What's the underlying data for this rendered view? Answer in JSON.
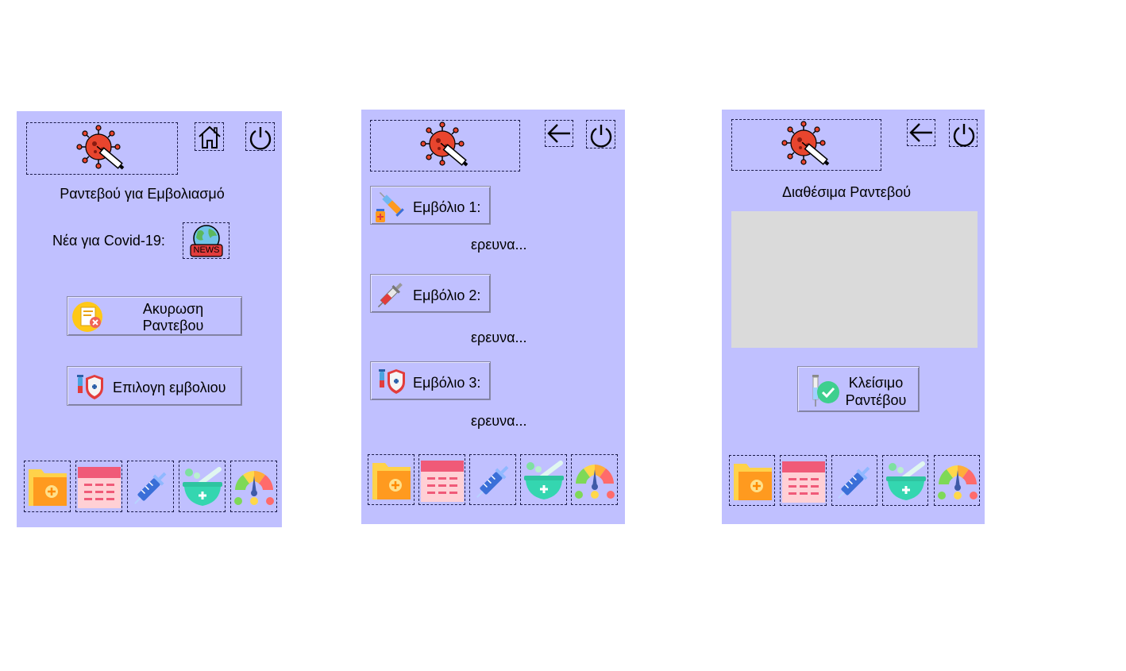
{
  "screen1": {
    "title": "Ραντεβού για Εμβολιασμό",
    "news_label": "Νέα για Covid-19:",
    "news_icon_text": "NEWS",
    "cancel_line1": "Ακυρωση",
    "cancel_line2": "Ραντεβου",
    "choose_label": "Επιλογη εμβολιου"
  },
  "screen2": {
    "vaccine1_label": "Εμβόλιο 1:",
    "vaccine1_status": "ερευνα...",
    "vaccine2_label": "Εμβόλιο 2:",
    "vaccine2_status": "ερευνα...",
    "vaccine3_label": "Εμβόλιο 3:",
    "vaccine3_status": "ερευνα..."
  },
  "screen3": {
    "title": "Διαθέσιμα Ραντεβού",
    "close_line1": "Κλείσιμο",
    "close_line2": "Ραντέβου"
  },
  "bottom_nav_icons": [
    "folder-add-icon",
    "calendar-icon",
    "syringe-icon",
    "mortar-pestle-icon",
    "gauge-icon"
  ],
  "colors": {
    "screen_bg": "#c0c0ff",
    "list_box_bg": "#dadada",
    "virus_red": "#e8452e"
  }
}
